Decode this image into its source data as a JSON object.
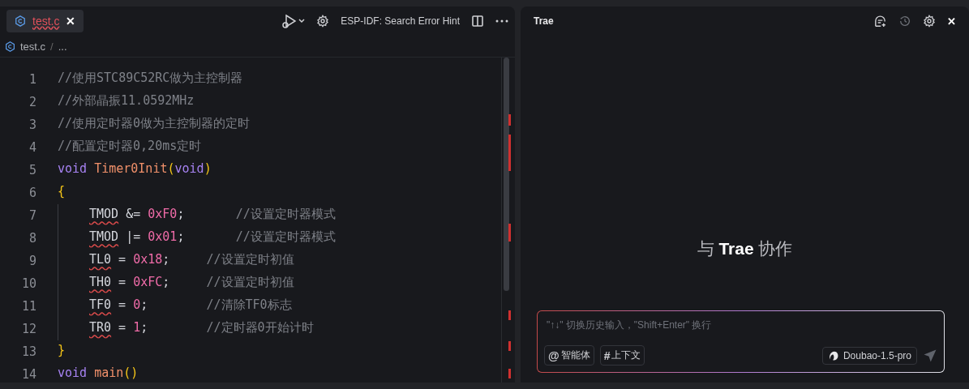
{
  "editor": {
    "tab": {
      "label": "test.c",
      "has_error": true,
      "selected": true,
      "close": "✕"
    },
    "toolbar": {
      "command": "ESP-IDF: Search Error Hint"
    },
    "breadcrumb": {
      "file": "test.c",
      "separator": "/",
      "rest": "..."
    },
    "lines": [
      {
        "number": "1",
        "indented": false,
        "tokens": [
          {
            "text": "//使用STC89C52RC做为主控制器",
            "kind": "comment",
            "error": false
          }
        ]
      },
      {
        "number": "2",
        "indented": false,
        "tokens": [
          {
            "text": "//外部晶振11.0592MHz",
            "kind": "comment",
            "error": false
          }
        ]
      },
      {
        "number": "3",
        "indented": false,
        "tokens": [
          {
            "text": "//使用定时器0做为主控制器的定时",
            "kind": "comment",
            "error": false
          }
        ]
      },
      {
        "number": "4",
        "indented": false,
        "tokens": [
          {
            "text": "//配置定时器0,20ms定时",
            "kind": "comment",
            "error": false
          }
        ]
      },
      {
        "number": "5",
        "indented": false,
        "tokens": [
          {
            "text": "void ",
            "kind": "keyword",
            "error": false
          },
          {
            "text": "Timer0Init",
            "kind": "function",
            "error": false
          },
          {
            "text": "(",
            "kind": "bracket",
            "error": false
          },
          {
            "text": "void",
            "kind": "keyword",
            "error": false
          },
          {
            "text": ")",
            "kind": "bracket",
            "error": false
          }
        ]
      },
      {
        "number": "6",
        "indented": false,
        "tokens": [
          {
            "text": "{",
            "kind": "bracket",
            "error": false
          }
        ]
      },
      {
        "number": "7",
        "indented": true,
        "tokens": [
          {
            "text": "TMOD",
            "kind": "plain",
            "error": true
          },
          {
            "text": " &= ",
            "kind": "plain",
            "error": false
          },
          {
            "text": "0xF0",
            "kind": "number",
            "error": false
          },
          {
            "text": ";       ",
            "kind": "plain",
            "error": false
          },
          {
            "text": "//设置定时器模式",
            "kind": "comment",
            "error": false
          }
        ]
      },
      {
        "number": "8",
        "indented": true,
        "tokens": [
          {
            "text": "TMOD",
            "kind": "plain",
            "error": true
          },
          {
            "text": " |= ",
            "kind": "plain",
            "error": false
          },
          {
            "text": "0x01",
            "kind": "number",
            "error": false
          },
          {
            "text": ";       ",
            "kind": "plain",
            "error": false
          },
          {
            "text": "//设置定时器模式",
            "kind": "comment",
            "error": false
          }
        ]
      },
      {
        "number": "9",
        "indented": true,
        "tokens": [
          {
            "text": "TL0",
            "kind": "plain",
            "error": true
          },
          {
            "text": " = ",
            "kind": "plain",
            "error": false
          },
          {
            "text": "0x18",
            "kind": "number",
            "error": false
          },
          {
            "text": ";     ",
            "kind": "plain",
            "error": false
          },
          {
            "text": "//设置定时初值",
            "kind": "comment",
            "error": false
          }
        ]
      },
      {
        "number": "10",
        "indented": true,
        "tokens": [
          {
            "text": "TH0",
            "kind": "plain",
            "error": true
          },
          {
            "text": " = ",
            "kind": "plain",
            "error": false
          },
          {
            "text": "0xFC",
            "kind": "number",
            "error": false
          },
          {
            "text": ";     ",
            "kind": "plain",
            "error": false
          },
          {
            "text": "//设置定时初值",
            "kind": "comment",
            "error": false
          }
        ]
      },
      {
        "number": "11",
        "indented": true,
        "tokens": [
          {
            "text": "TF0",
            "kind": "plain",
            "error": true
          },
          {
            "text": " = ",
            "kind": "plain",
            "error": false
          },
          {
            "text": "0",
            "kind": "number",
            "error": false
          },
          {
            "text": ";        ",
            "kind": "plain",
            "error": false
          },
          {
            "text": "//清除TF0标志",
            "kind": "comment",
            "error": false
          }
        ]
      },
      {
        "number": "12",
        "indented": true,
        "tokens": [
          {
            "text": "TR0",
            "kind": "plain",
            "error": true
          },
          {
            "text": " = ",
            "kind": "plain",
            "error": false
          },
          {
            "text": "1",
            "kind": "number",
            "error": false
          },
          {
            "text": ";        ",
            "kind": "plain",
            "error": false
          },
          {
            "text": "//定时器0开始计时",
            "kind": "comment",
            "error": false
          }
        ]
      },
      {
        "number": "13",
        "indented": false,
        "tokens": [
          {
            "text": "}",
            "kind": "bracket",
            "error": false
          }
        ]
      },
      {
        "number": "14",
        "indented": false,
        "tokens": [
          {
            "text": "void ",
            "kind": "keyword",
            "error": false
          },
          {
            "text": "main",
            "kind": "function",
            "error": false
          },
          {
            "text": "()",
            "kind": "bracket",
            "error": false
          }
        ]
      }
    ]
  },
  "chat": {
    "title": "Trae",
    "close": "✕",
    "welcome": {
      "before": "与",
      "brand": "Trae",
      "after": "协作"
    },
    "input": {
      "placeholder": "\"↑↓\" 切换历史输入，\"Shift+Enter\" 换行"
    },
    "chips": [
      {
        "symbol": "@",
        "label": "智能体"
      },
      {
        "symbol": "#",
        "label": "上下文"
      }
    ],
    "model": "Doubao-1.5-pro"
  }
}
